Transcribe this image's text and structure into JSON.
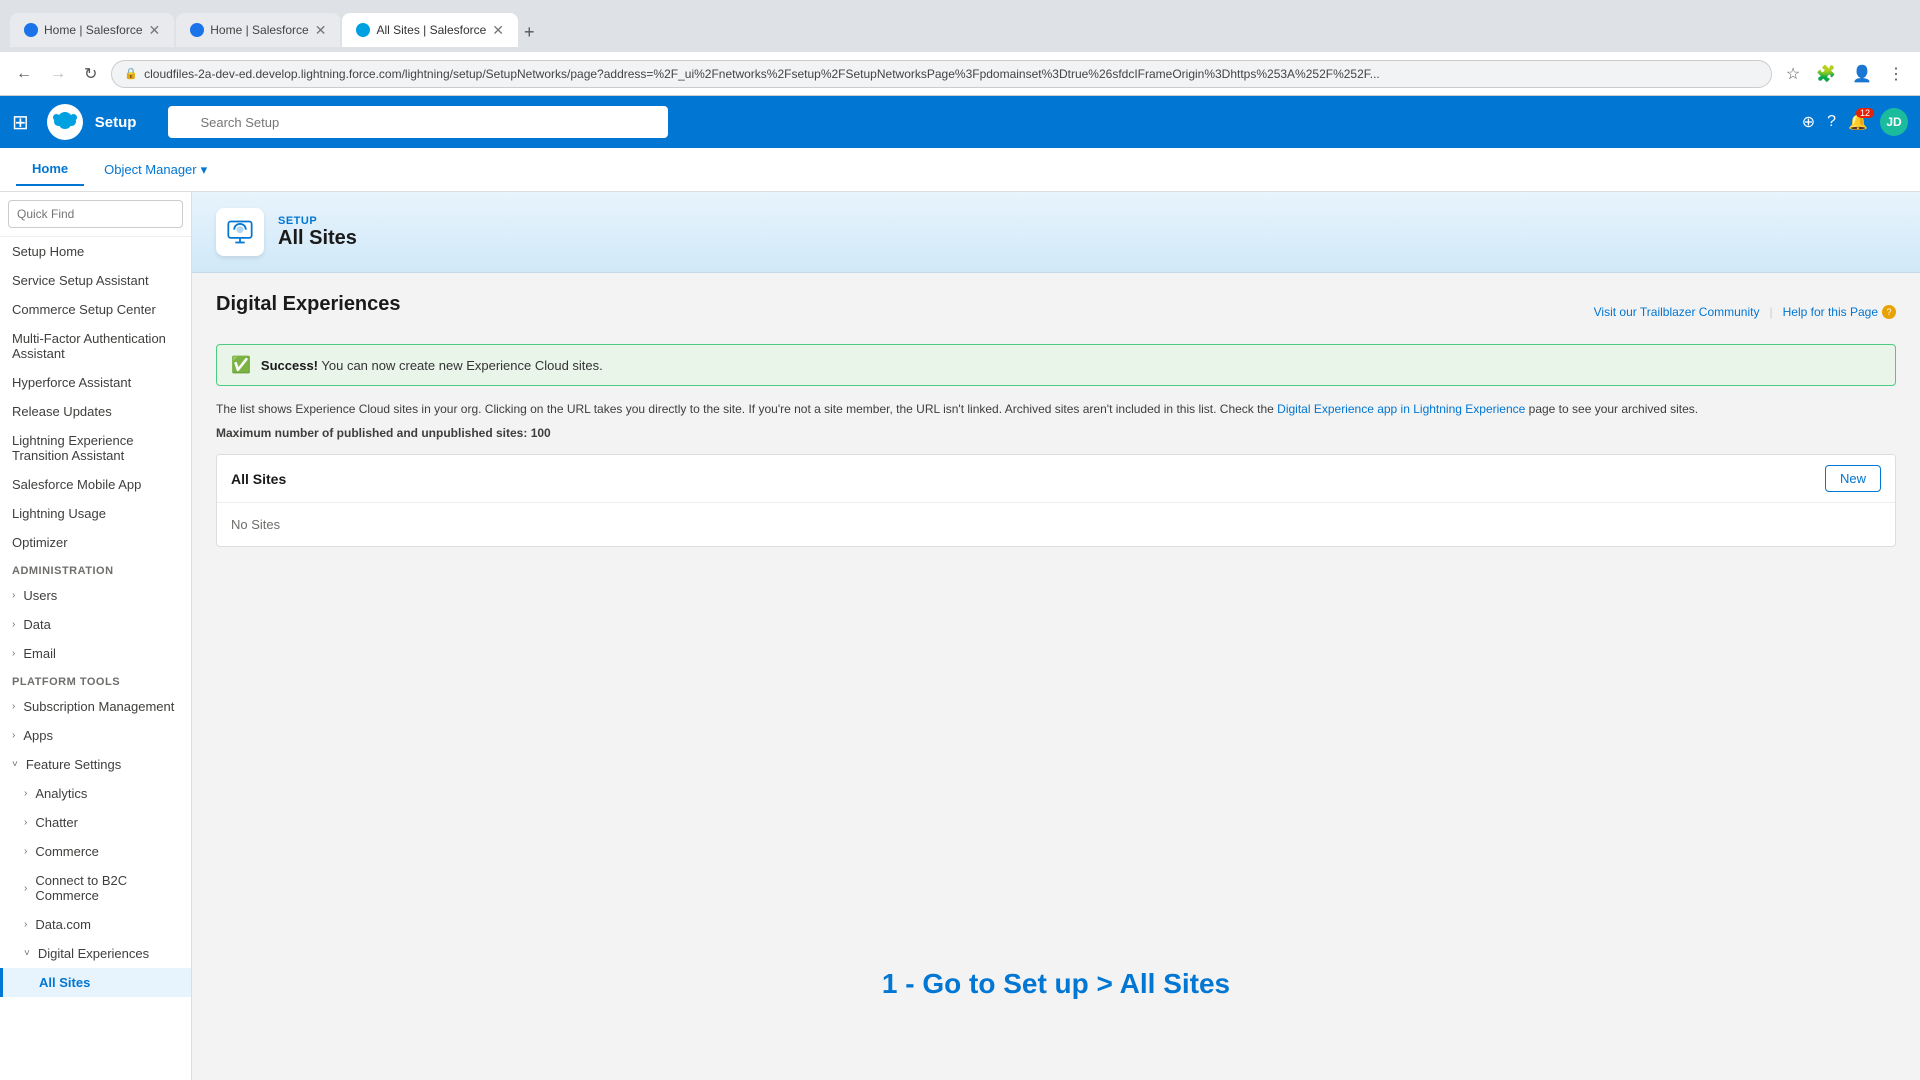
{
  "browser": {
    "tabs": [
      {
        "id": "tab1",
        "label": "Home | Salesforce",
        "favicon_color": "blue",
        "active": false
      },
      {
        "id": "tab2",
        "label": "Home | Salesforce",
        "favicon_color": "blue",
        "active": false
      },
      {
        "id": "tab3",
        "label": "All Sites | Salesforce",
        "favicon_color": "teal",
        "active": true
      }
    ],
    "url": "cloudfiles-2a-dev-ed.develop.lightning.force.com/lightning/setup/SetupNetworks/page?address=%2F_ui%2Fnetworks%2Fsetup%2FSetupNetworksPage%3Fpdomainset%3Dtrue%26sfdcIFrameOrigin%3Dhttps%253A%252F%252F...",
    "back_enabled": true,
    "forward_enabled": false
  },
  "app_header": {
    "setup_label": "Setup",
    "search_placeholder": "Search Setup",
    "nav_items": [
      "Home",
      "Object Manager"
    ],
    "notification_count": "12",
    "avatar_initials": "JD"
  },
  "sidebar": {
    "search_placeholder": "Quick Find",
    "items": [
      {
        "label": "Setup Home",
        "level": 0,
        "expandable": false,
        "active": false
      },
      {
        "label": "Service Setup Assistant",
        "level": 0,
        "expandable": false,
        "active": false
      },
      {
        "label": "Commerce Setup Center",
        "level": 0,
        "expandable": false,
        "active": false
      },
      {
        "label": "Multi-Factor Authentication Assistant",
        "level": 0,
        "expandable": false,
        "active": false
      },
      {
        "label": "Hyperforce Assistant",
        "level": 0,
        "expandable": false,
        "active": false
      },
      {
        "label": "Release Updates",
        "level": 0,
        "expandable": false,
        "active": false
      },
      {
        "label": "Lightning Experience Transition Assistant",
        "level": 0,
        "expandable": false,
        "active": false
      },
      {
        "label": "Salesforce Mobile App",
        "level": 0,
        "expandable": false,
        "active": false
      },
      {
        "label": "Lightning Usage",
        "level": 0,
        "expandable": false,
        "active": false
      },
      {
        "label": "Optimizer",
        "level": 0,
        "expandable": false,
        "active": false
      }
    ],
    "sections": [
      {
        "title": "ADMINISTRATION",
        "items": [
          {
            "label": "Users",
            "expandable": true
          },
          {
            "label": "Data",
            "expandable": true
          },
          {
            "label": "Email",
            "expandable": true
          }
        ]
      },
      {
        "title": "PLATFORM TOOLS",
        "items": [
          {
            "label": "Subscription Management",
            "expandable": true
          },
          {
            "label": "Apps",
            "expandable": true
          },
          {
            "label": "Feature Settings",
            "expandable": false,
            "expanded": true,
            "children": [
              {
                "label": "Analytics",
                "expandable": true
              },
              {
                "label": "Chatter",
                "expandable": true
              },
              {
                "label": "Commerce",
                "expandable": true
              },
              {
                "label": "Connect to B2C Commerce",
                "expandable": true
              },
              {
                "label": "Data.com",
                "expandable": true
              },
              {
                "label": "Digital Experiences",
                "expandable": true,
                "expanded": true,
                "children": [
                  {
                    "label": "All Sites",
                    "active": true
                  }
                ]
              }
            ]
          }
        ]
      }
    ]
  },
  "page_header": {
    "setup_label": "SETUP",
    "page_title": "All Sites"
  },
  "content": {
    "title": "Digital Experiences",
    "trailblazer_link": "Visit our Trailblazer Community",
    "help_link": "Help for this Page",
    "success_message": {
      "bold": "Success!",
      "text": "You can now create new Experience Cloud sites."
    },
    "info_text": "The list shows Experience Cloud sites in your org. Clicking on the URL takes you directly to the site. If you're not a site member, the URL isn't linked. Archived sites aren't included in this list. Check the",
    "info_link_text": "Digital Experience app in Lightning Experience",
    "info_text2": "page to see your archived sites.",
    "max_sites_text": "Maximum number of published and unpublished sites: 100",
    "table": {
      "title": "All Sites",
      "new_button_label": "New",
      "empty_text": "No Sites"
    },
    "watermark": "1 - Go to Set up > All Sites"
  }
}
